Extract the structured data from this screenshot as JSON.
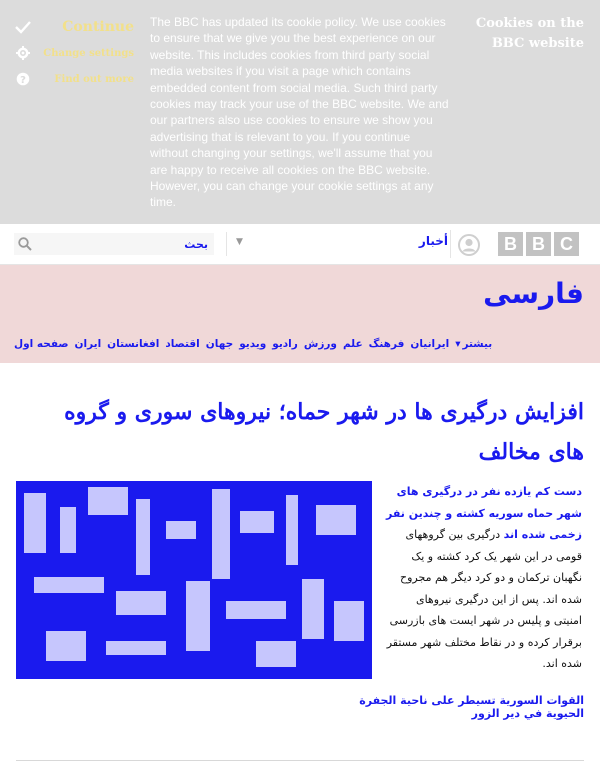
{
  "cookie_banner": {
    "continue_label": "Continue",
    "change_settings_label": "Change settings",
    "find_out_more_label": "Find out more",
    "title": "Cookies on the BBC website",
    "body": "The BBC has updated its cookie policy. We use cookies to ensure that we give you the best experience on our website. This includes cookies from third party social media websites if you visit a page which contains embedded content from social media. Such third party cookies may track your use of the BBC website. We and our partners also use cookies to ensure we show you advertising that is relevant to you. If you continue without changing your settings, we'll assume that you are happy to receive all cookies on the BBC website. However, you can change your cookie settings at any time."
  },
  "header": {
    "search_placeholder": "بحث",
    "nav_link": "أخبار",
    "logo_letters": [
      "B",
      "B",
      "C"
    ]
  },
  "brand": {
    "title": "فارسی",
    "nav": [
      "صفحه اول",
      "ایران",
      "افغانستان",
      "اقتصاد",
      "جهان",
      "ویدیو",
      "رادیو",
      "ورزش",
      "علم",
      "فرهنگ",
      "ایرانیان"
    ],
    "more_label": "بیشتر"
  },
  "article": {
    "headline": "افزایش درگیری ها در شهر حماه؛ نیروهای سوری و گروه های مخالف",
    "lead_highlight": "دست کم یازده نفر در درگیری های شهر حماه سوریه کشته و چندین نفر زخمی شده اند",
    "body": "درگیری بین گروههای قومی در این شهر یک کرد کشته و یک نگهبان ترکمان و دو کرد دیگر هم مجروح شده اند. پس از این درگیری نیروهای امنیتی و پلیس در شهر ایست های بازرسی برقرار کرده و در نقاط مختلف شهر مستقر شده اند.",
    "overlay": "القوات السورية تسيطر على ناحية الجفرة الحيوية في دير الزور"
  },
  "colors": {
    "accent": "#1a1aee",
    "banner_bg": "#dcdcdc",
    "brand_bg": "#f0d8d8",
    "cookie_action": "#f2e08a"
  }
}
